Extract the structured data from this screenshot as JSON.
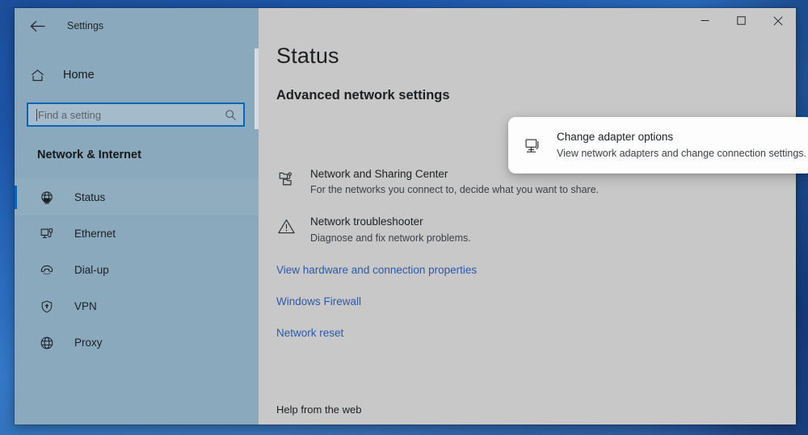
{
  "window": {
    "title": "Settings",
    "back_icon": "back-arrow-icon",
    "controls": {
      "minimize_label": "–",
      "maximize_label": "□",
      "close_label": "✕"
    }
  },
  "sidebar": {
    "home": {
      "label": "Home",
      "icon": "home-icon"
    },
    "search": {
      "placeholder": "Find a setting",
      "value": "",
      "icon": "search-icon",
      "focused": true
    },
    "section_header": "Network & Internet",
    "items": [
      {
        "label": "Status",
        "icon": "network-status-icon",
        "selected": true
      },
      {
        "label": "Ethernet",
        "icon": "ethernet-icon",
        "selected": false
      },
      {
        "label": "Dial-up",
        "icon": "dial-up-icon",
        "selected": false
      },
      {
        "label": "VPN",
        "icon": "vpn-shield-icon",
        "selected": false
      },
      {
        "label": "Proxy",
        "icon": "proxy-globe-icon",
        "selected": false
      }
    ]
  },
  "main": {
    "page_title": "Status",
    "section_title": "Advanced network settings",
    "highlighted_card": {
      "title": "Change adapter options",
      "subtitle": "View network adapters and change connection settings.",
      "icon": "adapter-monitor-icon"
    },
    "options": [
      {
        "title": "Network and Sharing Center",
        "subtitle": "For the networks you connect to, decide what you want to share.",
        "icon": "sharing-center-icon"
      },
      {
        "title": "Network troubleshooter",
        "subtitle": "Diagnose and fix network problems.",
        "icon": "warning-triangle-icon"
      }
    ],
    "links": [
      {
        "label": "View hardware and connection properties"
      },
      {
        "label": "Windows Firewall"
      },
      {
        "label": "Network reset"
      }
    ],
    "help_heading": "Help from the web"
  },
  "colors": {
    "accent": "#0a64b8",
    "link": "#2c59a8",
    "sidebar_bg": "#8ba9bd",
    "content_bg": "#c8c8c8",
    "card_bg": "#fdfdfd"
  }
}
